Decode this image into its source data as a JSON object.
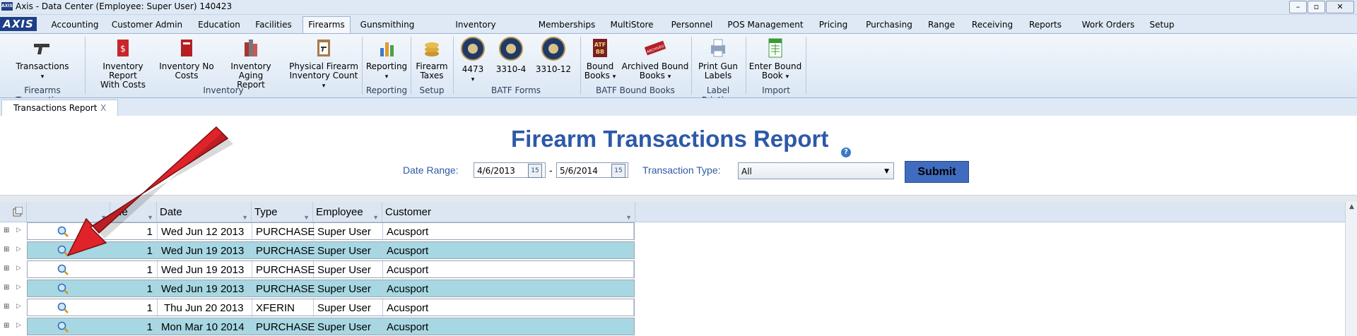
{
  "window": {
    "app_icon_text": "AXIS",
    "title": "Axis - Data Center  (Employee: Super User) 140423"
  },
  "menu": {
    "logo": "AXIS",
    "tabs": [
      "Accounting",
      "Customer Admin",
      "Education",
      "Facilities",
      "Firearms",
      "Gunsmithing",
      "Inventory Management",
      "Memberships",
      "MultiStore",
      "Personnel",
      "POS Management",
      "Pricing",
      "Purchasing",
      "Range",
      "Receiving",
      "Reports",
      "Work Orders",
      "Setup"
    ],
    "active_tab": "Firearms"
  },
  "ribbon": {
    "buttons": {
      "transactions": "Transactions",
      "inv_report_costs_1": "Inventory Report",
      "inv_report_costs_2": "With Costs",
      "inv_no_costs_1": "Inventory No",
      "inv_no_costs_2": "Costs",
      "inv_aging_1": "Inventory Aging",
      "inv_aging_2": "Report",
      "physical_1": "Physical Firearm",
      "physical_2": "Inventory Count",
      "reporting": "Reporting",
      "firearm_taxes_1": "Firearm",
      "firearm_taxes_2": "Taxes",
      "f4473": "4473",
      "f3310_4": "3310-4",
      "f3310_12": "3310-12",
      "bound_books_1": "Bound",
      "bound_books_2": "Books",
      "archived_1": "Archived Bound",
      "archived_2": "Books",
      "print_gun_1": "Print Gun",
      "print_gun_2": "Labels",
      "enter_bound_1": "Enter Bound",
      "enter_bound_2": "Book"
    },
    "groups": {
      "firearms_transactions": "Firearms Transactions",
      "inventory": "Inventory",
      "reporting": "Reporting",
      "setup": "Setup",
      "batf_forms": "BATF Forms",
      "batf_bound_books": "BATF Bound Books",
      "label_printing": "Label Printing",
      "import": "Import"
    },
    "icon_text": {
      "atf_bb_1": "ATF",
      "atf_bb_2": "BB",
      "archived_stamp": "ARCHIVED"
    }
  },
  "doc_tab": {
    "label": "Transactions Report",
    "close": "X"
  },
  "report": {
    "title": "Firearm Transactions Report",
    "help": "?",
    "date_range_label": "Date Range:",
    "date_from": "4/6/2013",
    "date_sep": "-",
    "date_to": "5/6/2014",
    "calendar_text": "15",
    "transaction_type_label": "Transaction Type:",
    "transaction_type_value": "All",
    "submit": "Submit"
  },
  "grid": {
    "columns": [
      "",
      "...e",
      "Date",
      "Type",
      "Employee",
      "Customer"
    ],
    "rows": [
      {
        "qty": "1",
        "date": "Wed Jun 12 2013",
        "type": "PURCHASE",
        "employee": "Super User",
        "customer": "Acusport"
      },
      {
        "qty": "1",
        "date": "Wed Jun 19 2013",
        "type": "PURCHASE",
        "employee": "Super User",
        "customer": "Acusport"
      },
      {
        "qty": "1",
        "date": "Wed Jun 19 2013",
        "type": "PURCHASE",
        "employee": "Super User",
        "customer": "Acusport"
      },
      {
        "qty": "1",
        "date": "Wed Jun 19 2013",
        "type": "PURCHASE",
        "employee": "Super User",
        "customer": "Acusport"
      },
      {
        "qty": "1",
        "date": "Thu Jun 20 2013",
        "type": "XFERIN",
        "employee": "Super User",
        "customer": "Acusport"
      },
      {
        "qty": "1",
        "date": "Mon Mar 10 2014",
        "type": "PURCHASE",
        "employee": "Super User",
        "customer": "Acusport"
      }
    ]
  },
  "colors": {
    "accent": "#2e59a8",
    "row_alt": "#a7d7e2",
    "arrow": "#e0232a",
    "submit": "#3f6cbf"
  }
}
